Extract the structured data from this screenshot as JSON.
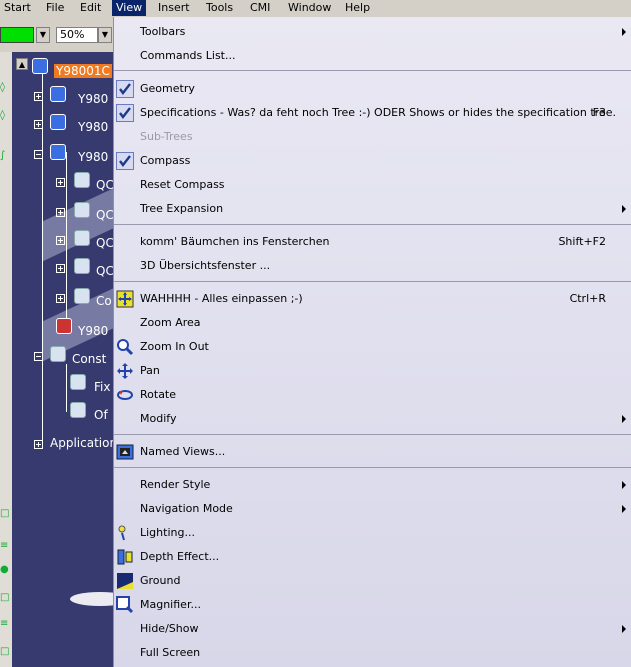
{
  "menubar": {
    "items": [
      "Start",
      "File",
      "Edit",
      "View",
      "Insert",
      "Tools",
      "CMI",
      "Window",
      "Help"
    ],
    "active": "View"
  },
  "toolbar": {
    "zoom": "50%",
    "color": "#00e000"
  },
  "tree": {
    "root": "Y98001C",
    "nodes": [
      "Y980",
      "Y980",
      "Y980",
      "QC",
      "QC",
      "QC",
      "QC",
      "Co",
      "Y980",
      "Const",
      "Fix",
      "Of",
      "Application"
    ]
  },
  "menu": {
    "toolbars": "Toolbars",
    "commands_list": "Commands List...",
    "geometry": "Geometry",
    "specifications": "Specifications - Was? da feht noch Tree  :-) ODER Shows or hides the specification tree.",
    "specifications_sc": "F3",
    "sub_trees": "Sub-Trees",
    "compass": "Compass",
    "reset_compass": "Reset Compass",
    "tree_expansion": "Tree Expansion",
    "baumchen": "komm' Bäumchen ins Fensterchen",
    "baumchen_sc": "Shift+F2",
    "ubersicht": "3D Übersichtsfenster ...",
    "wahhhh": "WAHHHH - Alles einpassen ;-)",
    "wahhhh_sc": "Ctrl+R",
    "zoom_area": "Zoom Area",
    "zoom_in_out": "Zoom In Out",
    "pan": "Pan",
    "rotate": "Rotate",
    "modify": "Modify",
    "named_views": "Named Views...",
    "render_style": "Render Style",
    "navigation_mode": "Navigation Mode",
    "lighting": "Lighting...",
    "depth_effect": "Depth Effect...",
    "ground": "Ground",
    "magnifier": "Magnifier...",
    "hide_show": "Hide/Show",
    "full_screen": "Full Screen"
  }
}
